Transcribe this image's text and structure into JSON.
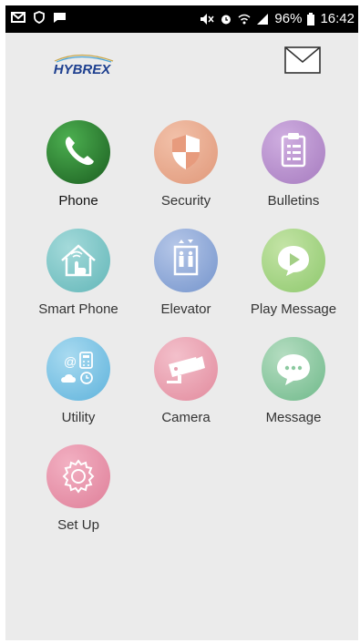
{
  "status_bar": {
    "battery": "96%",
    "time": "16:42",
    "left_icons": [
      "mail-icon",
      "shield-icon",
      "chat-icon"
    ],
    "right_icons": [
      "mute-icon",
      "alarm-icon",
      "wifi-icon",
      "signal-icon",
      "battery-icon"
    ]
  },
  "header": {
    "logo_text": "HYBREX",
    "mail_icon": "envelope-icon"
  },
  "colors": {
    "background": "#ebebeb",
    "phone": "#2e7d32",
    "security": "#e8a78a",
    "bulletins": "#b48cc9",
    "smart_phone": "#7ec8c8",
    "elevator": "#8ea8d8",
    "play_message": "#a7d58b",
    "utility": "#7cc7e8",
    "camera": "#e89aaa",
    "message": "#8cc9a1",
    "set_up": "#e88aa3"
  },
  "apps": [
    {
      "label": "Phone",
      "icon": "phone-icon"
    },
    {
      "label": "Security",
      "icon": "shield-icon"
    },
    {
      "label": "Bulletins",
      "icon": "clipboard-icon"
    },
    {
      "label": "Smart Phone",
      "icon": "house-hand-icon"
    },
    {
      "label": "Elevator",
      "icon": "elevator-icon"
    },
    {
      "label": "Play Message",
      "icon": "play-message-icon"
    },
    {
      "label": "Utility",
      "icon": "utility-icon"
    },
    {
      "label": "Camera",
      "icon": "camera-icon"
    },
    {
      "label": "Message",
      "icon": "message-icon"
    },
    {
      "label": "Set Up",
      "icon": "gear-icon"
    }
  ]
}
